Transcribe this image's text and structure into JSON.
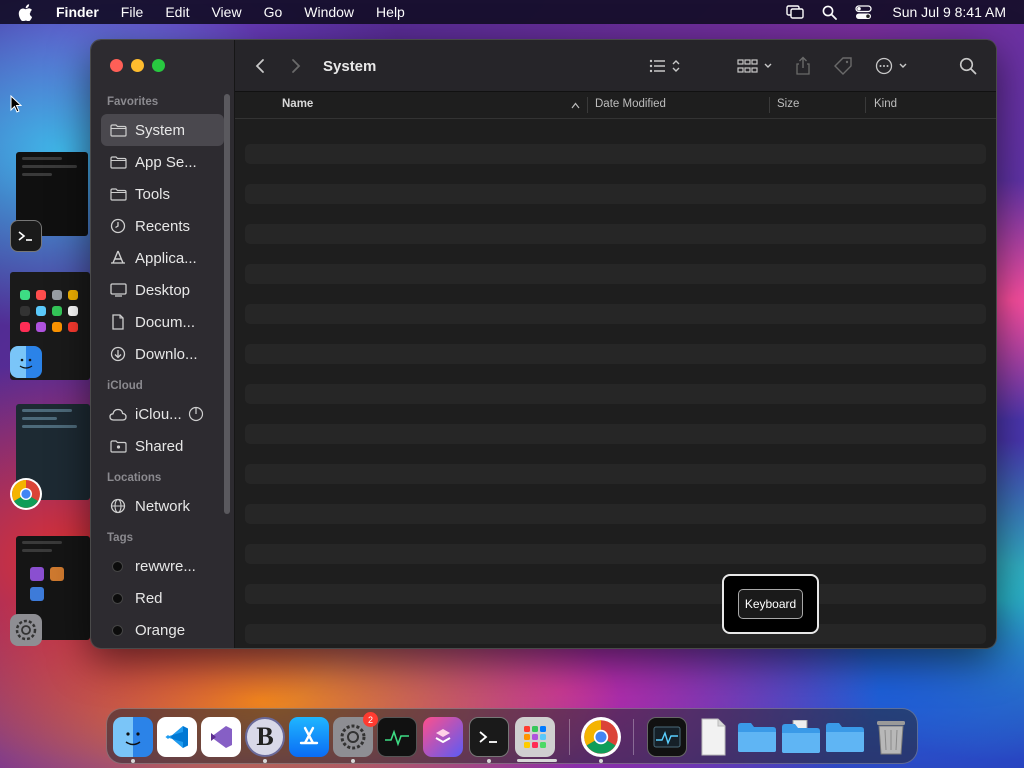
{
  "menubar": {
    "app_name": "Finder",
    "items": [
      "File",
      "Edit",
      "View",
      "Go",
      "Window",
      "Help"
    ],
    "clock": "Sun Jul 9  8:41 AM",
    "icons": [
      "apple-icon",
      "screen-mirroring-icon",
      "spotlight-icon",
      "control-center-icon"
    ]
  },
  "window": {
    "title": "System",
    "toolbar_icons": [
      "back-icon",
      "forward-icon",
      "list-view-icon",
      "group-icon",
      "share-icon",
      "tag-icon",
      "more-icon",
      "search-icon"
    ]
  },
  "sidebar": {
    "favorites_title": "Favorites",
    "favorites": [
      {
        "label": "System",
        "icon": "folder-icon"
      },
      {
        "label": "App Se...",
        "icon": "folder-icon"
      },
      {
        "label": "Tools",
        "icon": "folder-icon"
      },
      {
        "label": "Recents",
        "icon": "clock-icon"
      },
      {
        "label": "Applica...",
        "icon": "applications-icon"
      },
      {
        "label": "Desktop",
        "icon": "desktop-icon"
      },
      {
        "label": "Docum...",
        "icon": "document-icon"
      },
      {
        "label": "Downlo...",
        "icon": "download-icon"
      }
    ],
    "icloud_title": "iCloud",
    "icloud": [
      {
        "label": "iClou...",
        "icon": "cloud-icon"
      },
      {
        "label": "Shared",
        "icon": "shared-folder-icon"
      }
    ],
    "locations_title": "Locations",
    "locations": [
      {
        "label": "Network",
        "icon": "globe-icon"
      }
    ],
    "tags_title": "Tags",
    "tags": [
      {
        "label": "rewwre..."
      },
      {
        "label": "Red"
      },
      {
        "label": "Orange"
      }
    ]
  },
  "columns": {
    "name": "Name",
    "date_modified": "Date Modified",
    "size": "Size",
    "kind": "Kind"
  },
  "popup": {
    "button_label": "Keyboard"
  },
  "dock": {
    "icons": [
      "finder-icon",
      "vscode-icon",
      "visual-studio-icon",
      "bbedit-icon",
      "app-store-icon",
      "system-settings-icon",
      "activity-monitor-icon",
      "shortcuts-icon",
      "terminal-icon",
      "launchpad-icon",
      "chrome-icon",
      "activity-monitor-window-icon",
      "document-file-icon",
      "folder-icon",
      "documents-folder-icon",
      "downloads-folder-icon",
      "trash-icon"
    ],
    "settings_badge": "2"
  },
  "colors": {
    "accent_close": "#ff5f57",
    "accent_min": "#febc2e",
    "accent_max": "#28c840",
    "sidebar_bg": "#2d2b30",
    "content_bg": "#1e1e1e"
  }
}
